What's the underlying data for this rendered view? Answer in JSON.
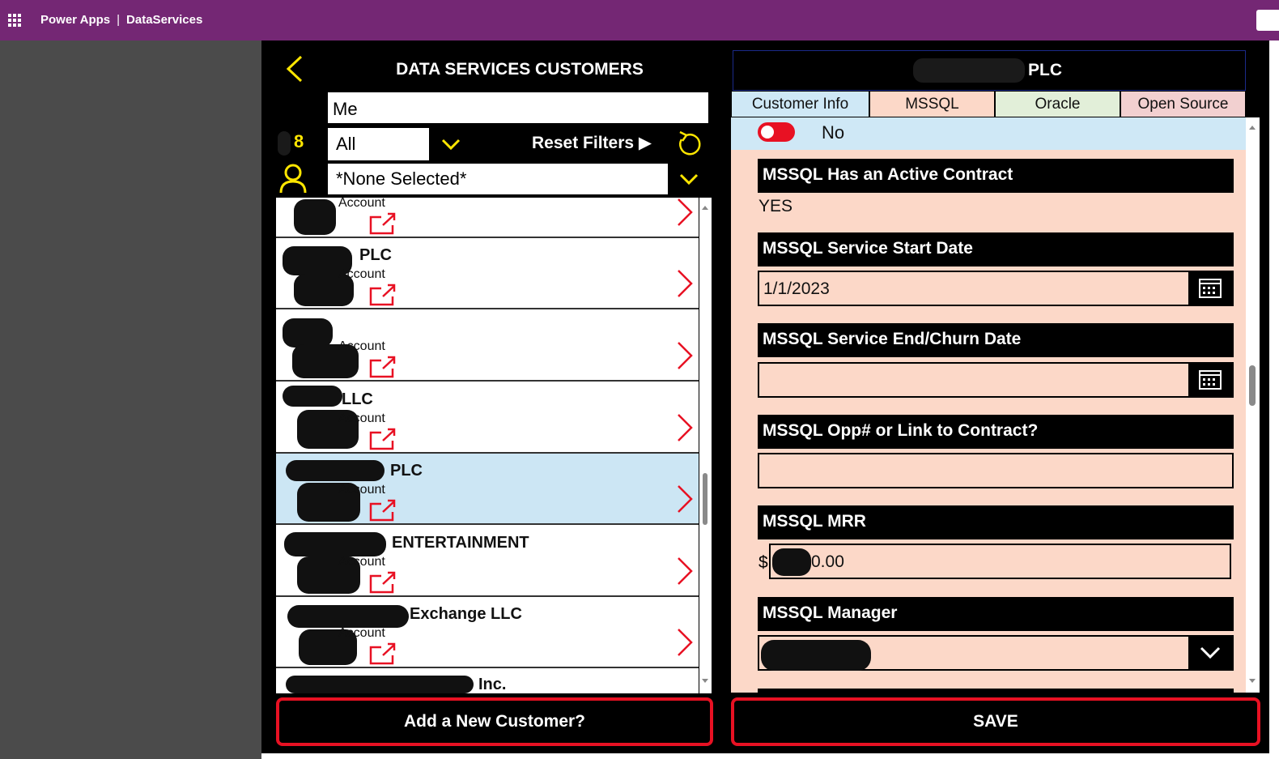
{
  "topbar": {
    "app_name": "Power Apps",
    "separator": "|",
    "environment": "DataServices"
  },
  "left_panel": {
    "title": "DATA SERVICES CUSTOMERS",
    "search_value": "Me",
    "count": "8",
    "filter_value": "All",
    "reset_label": "Reset Filters ▶",
    "owner_value": "*None Selected*",
    "rows": [
      {
        "name": "",
        "type": "Account"
      },
      {
        "name": "PLC",
        "type": "Account"
      },
      {
        "name": "",
        "type": "Account"
      },
      {
        "name": "LLC",
        "type": "Account"
      },
      {
        "name": "PLC",
        "type": "Account",
        "selected": true
      },
      {
        "name": "ENTERTAINMENT",
        "type": "Account"
      },
      {
        "name": "Exchange LLC",
        "type": "Account"
      },
      {
        "name": "Inc.",
        "type": ""
      }
    ],
    "add_button": "Add a New Customer?"
  },
  "detail": {
    "title": "PLC",
    "tabs": [
      {
        "label": "Customer Info",
        "color": "#cfe8f6"
      },
      {
        "label": "MSSQL",
        "color": "#fcd8c8"
      },
      {
        "label": "Oracle",
        "color": "#e2efd9"
      },
      {
        "label": "Open Source",
        "color": "#f2d0d0"
      }
    ],
    "toggle_label": "No",
    "fields": {
      "active_contract_label": "MSSQL Has an Active Contract",
      "active_contract_value": "YES",
      "start_date_label": "MSSQL Service Start Date",
      "start_date_value": "1/1/2023",
      "end_date_label": "MSSQL Service End/Churn Date",
      "end_date_value": "",
      "opp_label": "MSSQL Opp# or Link to Contract?",
      "opp_value": "",
      "mrr_label": "MSSQL MRR",
      "mrr_currency": "$",
      "mrr_value": "0.00",
      "manager_label": "MSSQL Manager"
    },
    "save_button": "SAVE"
  },
  "colors": {
    "brand_purple": "#742774",
    "accent_yellow": "#ffe600",
    "alert_red": "#e81123",
    "selected_row": "#cce6f4"
  }
}
